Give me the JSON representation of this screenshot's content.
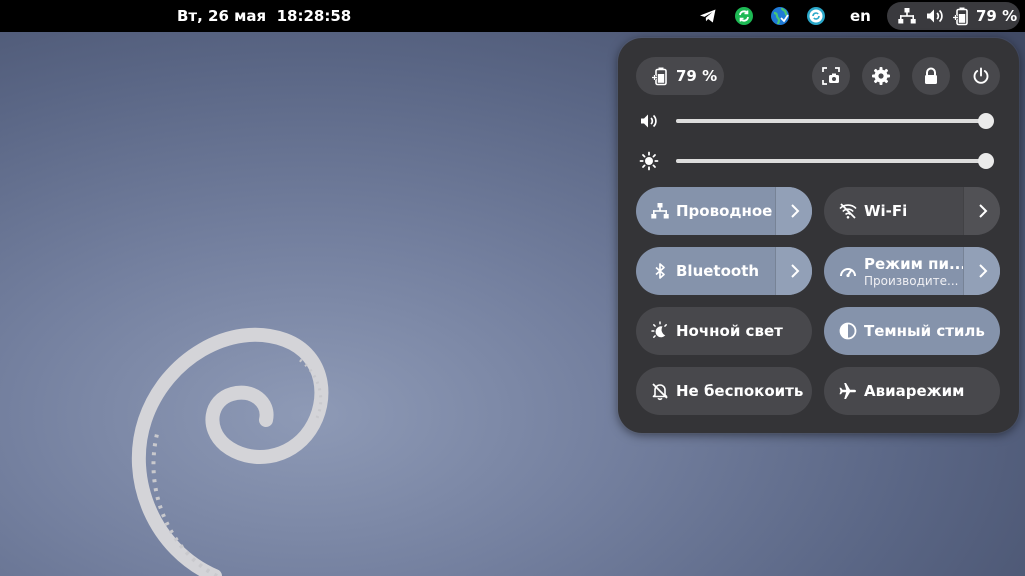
{
  "topbar": {
    "clock": "Вт, 26 мая  18:28:58",
    "tray_icons": [
      "telegram-icon",
      "sync-icon",
      "earth-icon",
      "refresh-icon"
    ],
    "language": "en",
    "battery_percent": "79 %",
    "colors": {
      "bar": "#000000",
      "pill": "#3a3a3e"
    }
  },
  "quick_settings": {
    "battery_percent": "79 %",
    "buttons": [
      "screenshot-icon",
      "settings-icon",
      "lock-icon",
      "power-icon"
    ],
    "volume_level": 1.0,
    "brightness_level": 1.0,
    "toggles": [
      {
        "label": "Проводное",
        "state": "on",
        "icon": "network-icon",
        "has_menu": true
      },
      {
        "label": "Wi-Fi",
        "state": "off",
        "icon": "wifi-off-icon",
        "has_menu": true
      },
      {
        "label": "Bluetooth",
        "state": "on",
        "icon": "bluetooth-icon",
        "has_menu": true
      },
      {
        "label": "Режим пи...",
        "sublabel": "Производите...",
        "state": "on",
        "icon": "power-mode-icon",
        "has_menu": true
      },
      {
        "label": "Ночной свет",
        "state": "off",
        "icon": "night-light-icon",
        "has_menu": false
      },
      {
        "label": "Темный стиль",
        "state": "on",
        "icon": "dark-style-icon",
        "has_menu": false
      },
      {
        "label": "Не беспокоить",
        "state": "off",
        "icon": "bell-off-icon",
        "has_menu": false
      },
      {
        "label": "Авиарежим",
        "state": "off",
        "icon": "airplane-icon",
        "has_menu": false
      }
    ],
    "colors": {
      "panel": "#343437",
      "toggle_off": "#48484c",
      "toggle_on": "#8593ab"
    }
  }
}
